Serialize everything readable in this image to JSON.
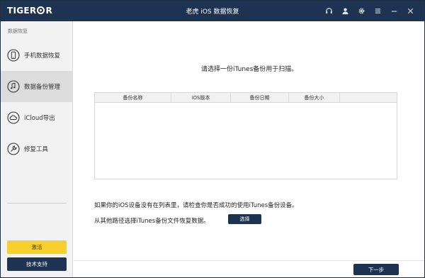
{
  "app": {
    "logo_left": "TIGER",
    "logo_right": "R",
    "title": "老虎 iOS 数据恢复"
  },
  "titlebar_icons": [
    "headset-icon",
    "user-icon",
    "gear-icon",
    "menu-icon",
    "minimize-icon",
    "close-icon"
  ],
  "sidebar": {
    "section_label": "数据恢复",
    "items": [
      {
        "label": "手机数据恢复",
        "icon": "phone-icon",
        "active": false
      },
      {
        "label": "数据备份管理",
        "icon": "backup-icon",
        "active": true
      },
      {
        "label": "iCloud导出",
        "icon": "cloud-icon",
        "active": false
      },
      {
        "label": "修复工具",
        "icon": "wrench-icon",
        "active": false
      }
    ],
    "activate_label": "激活",
    "support_label": "技术支持"
  },
  "main": {
    "prompt": "请选择一份iTunes备份用于扫描。",
    "table": {
      "columns": [
        "备份名称",
        "iOS版本",
        "备份日期",
        "备份大小"
      ],
      "rows": []
    },
    "info_line1": "如果你的iOS设备没有在列表里，请检查你是否成功的使用iTunes备份设备。",
    "info_line2": "从其他路径选择iTunes备份文件恢复数据。",
    "select_label": "选择",
    "next_label": "下一步"
  },
  "colors": {
    "titlebar": "#1d3351",
    "accent_button": "#f7d02d",
    "dark_button": "#1d3351"
  }
}
